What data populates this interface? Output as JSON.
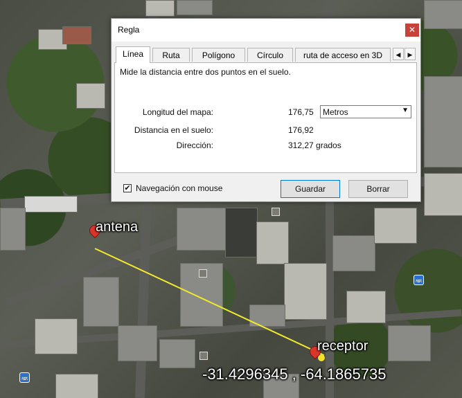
{
  "window": {
    "title": "Regla",
    "close_glyph": "✕"
  },
  "tabs": [
    {
      "label": "Línea",
      "active": true
    },
    {
      "label": "Ruta",
      "active": false
    },
    {
      "label": "Polígono",
      "active": false
    },
    {
      "label": "Círculo",
      "active": false
    },
    {
      "label": "ruta de acceso en 3D",
      "active": false
    }
  ],
  "tab_scroll": {
    "left_icon": "◀",
    "right_icon": "▶"
  },
  "panel": {
    "description": "Mide la distancia entre dos puntos en el suelo.",
    "map_length_label": "Longitud del mapa:",
    "map_length_value": "176,75",
    "unit_selected": "Metros",
    "unit_arrow": "▼",
    "ground_distance_label": "Distancia en el suelo:",
    "ground_distance_value": "176,92",
    "direction_label": "Dirección:",
    "direction_value": "312,27 grados"
  },
  "footer": {
    "mouse_nav_checked": true,
    "check_glyph": "✔",
    "mouse_nav_label": "Navegación con mouse",
    "save_label": "Guardar",
    "clear_label": "Borrar"
  },
  "map": {
    "placemark_a": "antena",
    "placemark_b": "receptor",
    "coordinates": "-31.4296345 , -64.1865735",
    "ruler_color": "#f2ea2a",
    "placemark_color": "#d8352b",
    "bus_icon_glyph": "🚌"
  }
}
